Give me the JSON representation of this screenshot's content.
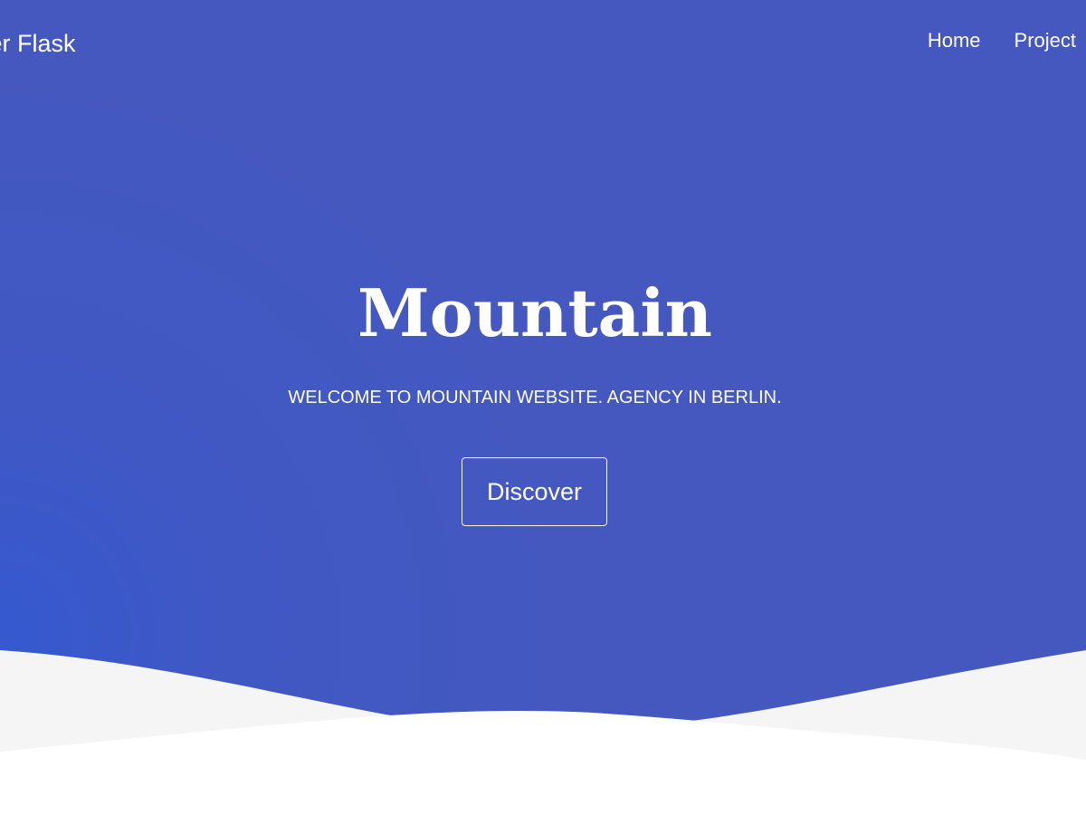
{
  "brand": {
    "text": "zer Flask"
  },
  "navigation": {
    "items": [
      {
        "label": "Home"
      },
      {
        "label": "Project"
      }
    ]
  },
  "hero": {
    "title": "Mountain",
    "subtitle": "WELCOME TO MOUNTAIN WEBSITE. AGENCY IN BERLIN.",
    "button_label": "Discover"
  },
  "colors": {
    "hero_blue": "#4458BF",
    "hero_blue_left": "#3559D0",
    "wave_light": "#F5F5F5",
    "text": "#FFFFFF"
  }
}
